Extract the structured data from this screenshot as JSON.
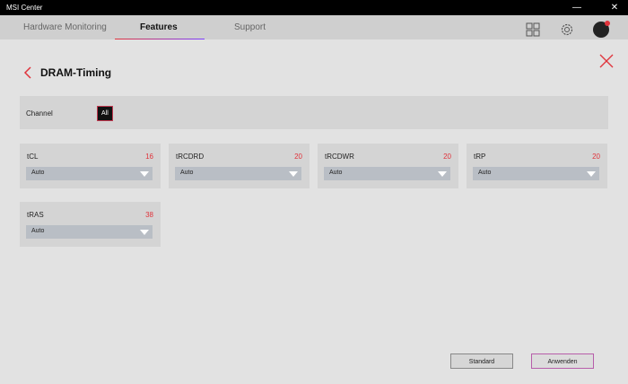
{
  "window": {
    "title": "MSI Center",
    "minimize": "—",
    "close": "✕"
  },
  "tabs": [
    {
      "label": "Hardware Monitoring"
    },
    {
      "label": "Features"
    },
    {
      "label": "Support"
    }
  ],
  "page": {
    "title": "DRAM-Timing"
  },
  "channel": {
    "label": "Channel",
    "value": "All"
  },
  "timings": [
    {
      "name": "tCL",
      "value": "16",
      "mode": "Auto"
    },
    {
      "name": "tRCDRD",
      "value": "20",
      "mode": "Auto"
    },
    {
      "name": "tRCDWR",
      "value": "20",
      "mode": "Auto"
    },
    {
      "name": "tRP",
      "value": "20",
      "mode": "Auto"
    },
    {
      "name": "tRAS",
      "value": "38",
      "mode": "Auto"
    }
  ],
  "actions": {
    "standard": "Standard",
    "apply": "Anwenden"
  },
  "colors": {
    "accent": "#e0333b",
    "background": "#e2e2e2",
    "card": "#d4d4d4"
  }
}
